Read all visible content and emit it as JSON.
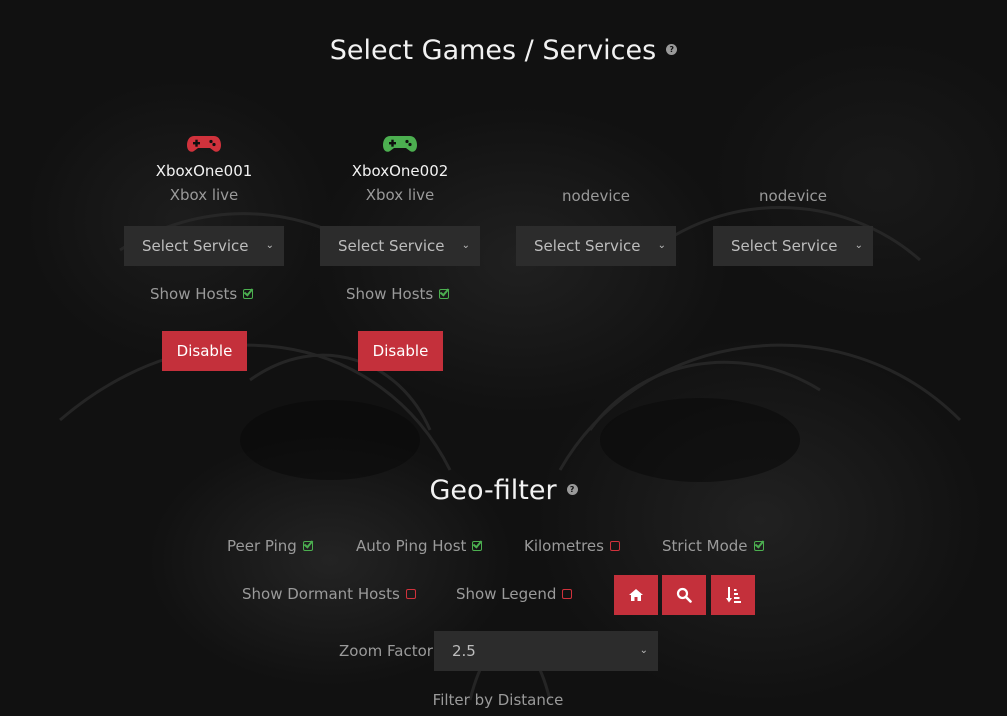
{
  "section_games": {
    "title": "Select Games / Services",
    "help": "?"
  },
  "devices": [
    {
      "name": "XboxOne001",
      "service": "Xbox live",
      "select": "Select Service",
      "show_hosts": "Show Hosts",
      "button": "Disable",
      "gamepad_color": "#d0323c",
      "active": true
    },
    {
      "name": "XboxOne002",
      "service": "Xbox live",
      "select": "Select Service",
      "show_hosts": "Show Hosts",
      "button": "Disable",
      "gamepad_color": "#4caf50",
      "active": true
    },
    {
      "name": "",
      "service": "nodevice",
      "select": "Select Service"
    },
    {
      "name": "",
      "service": "nodevice",
      "select": "Select Service"
    }
  ],
  "section_geo": {
    "title": "Geo-filter",
    "help": "?"
  },
  "geo_options": {
    "peer_ping": {
      "label": "Peer Ping",
      "checked": true
    },
    "auto_ping_host": {
      "label": "Auto Ping Host",
      "checked": true
    },
    "kilometres": {
      "label": "Kilometres",
      "checked": false
    },
    "strict_mode": {
      "label": "Strict Mode",
      "checked": true
    },
    "show_dormant_hosts": {
      "label": "Show Dormant Hosts",
      "checked": false
    },
    "show_legend": {
      "label": "Show Legend",
      "checked": false
    }
  },
  "geo_buttons": [
    "home-icon",
    "search-icon",
    "sort-icon"
  ],
  "zoom": {
    "label": "Zoom Factor",
    "value": "2.5"
  },
  "filter_distance": {
    "label": "Filter by Distance"
  },
  "colors": {
    "accent": "#c4303b",
    "check_on": "#4caf50",
    "check_off": "#d0323c",
    "select_bg": "#2c2c2c"
  }
}
